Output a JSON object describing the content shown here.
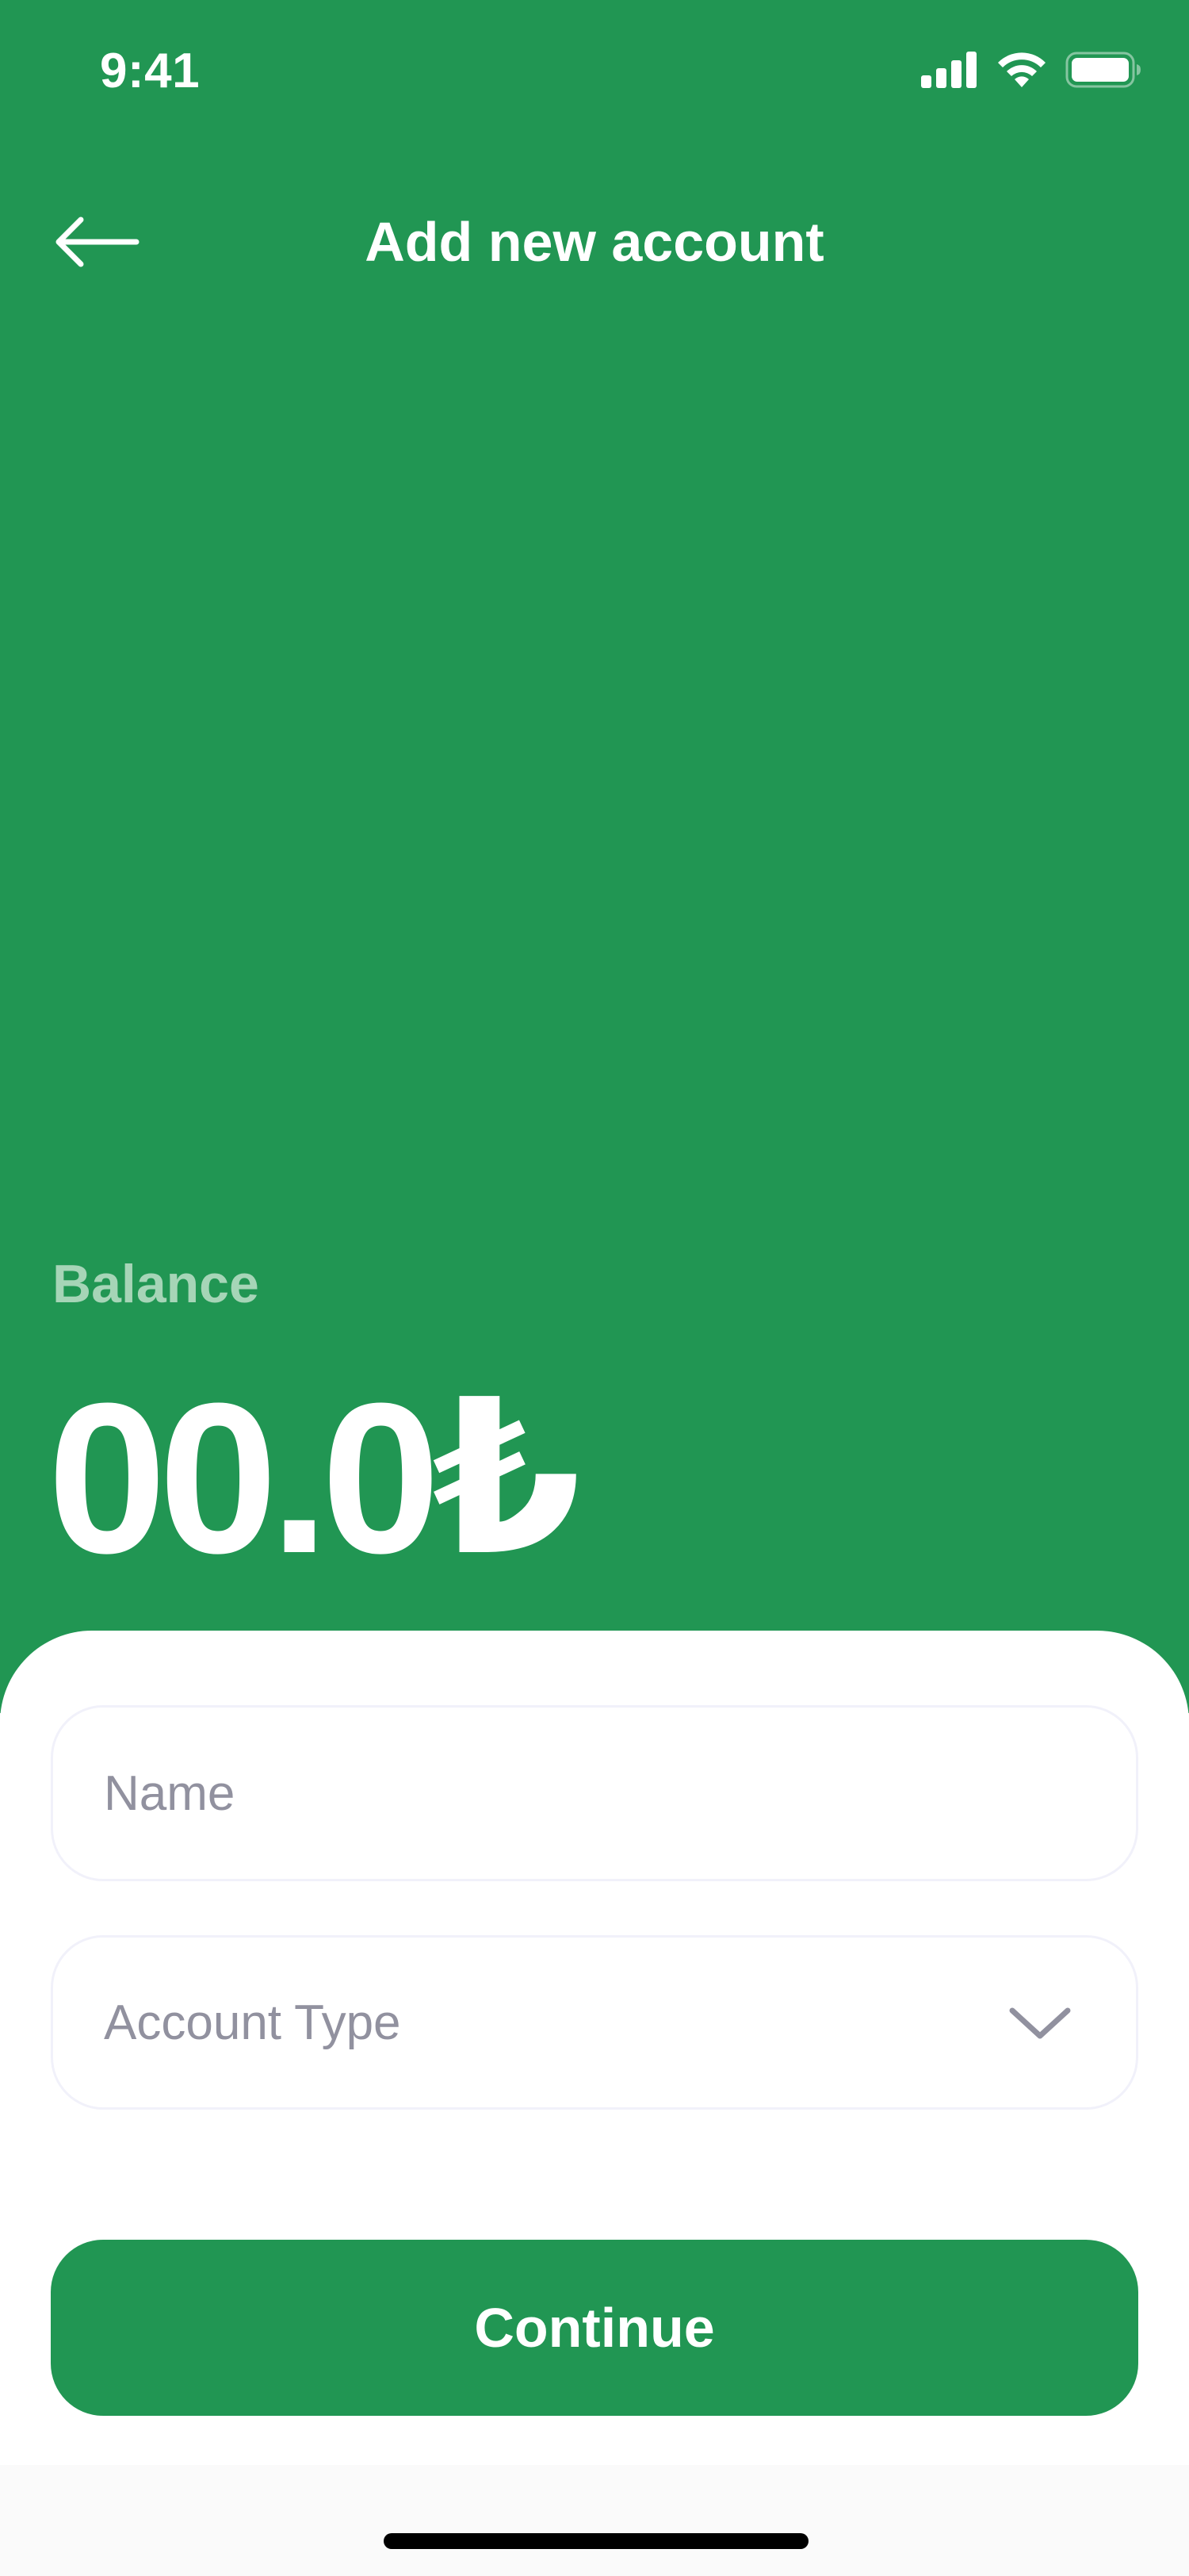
{
  "status_bar": {
    "time": "9:41"
  },
  "header": {
    "title": "Add new account",
    "back_icon": "arrow-left-icon"
  },
  "balance": {
    "label": "Balance",
    "amount": "00.0₺"
  },
  "form": {
    "name_placeholder": "Name",
    "account_type_placeholder": "Account Type",
    "dropdown_icon": "chevron-down-icon",
    "continue_label": "Continue"
  },
  "colors": {
    "primary_green": "#219653",
    "balance_label": "#A6D5B7",
    "placeholder": "#91919F",
    "field_border": "#F1F1FA"
  }
}
